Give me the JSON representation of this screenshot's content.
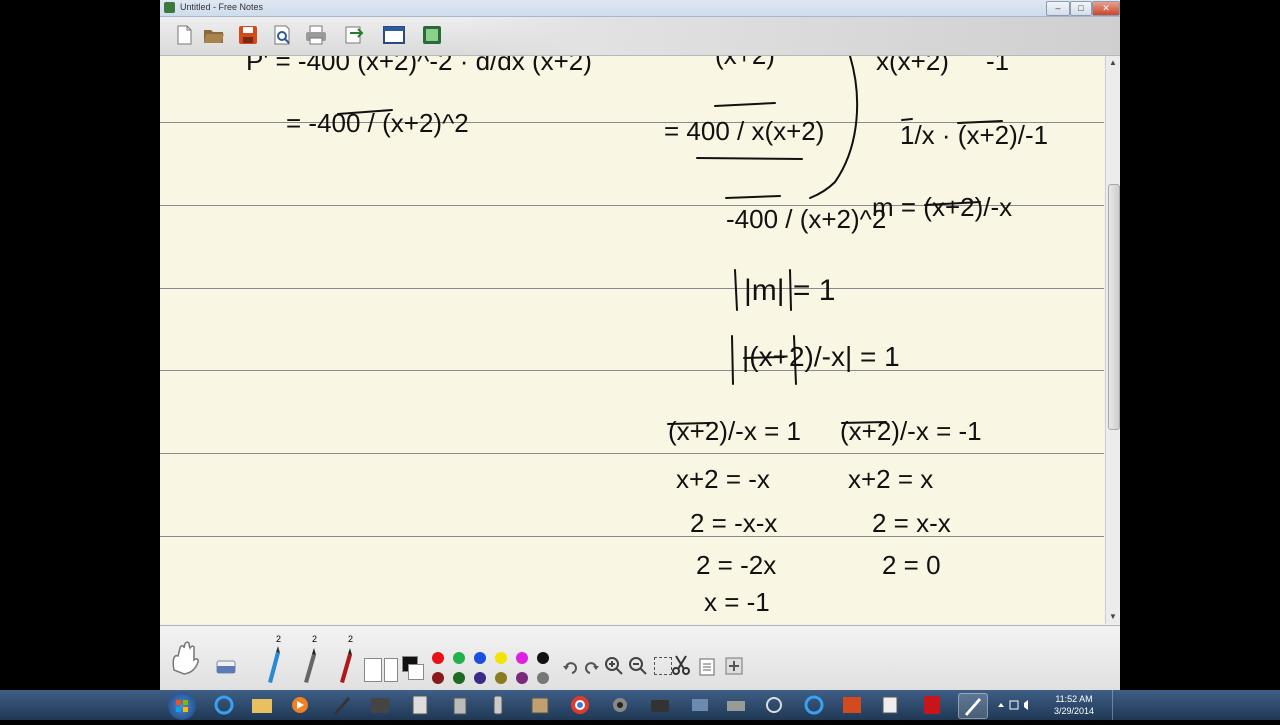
{
  "window": {
    "title": "Untitled - Free Notes",
    "controls": [
      "minimize",
      "maximize",
      "close"
    ]
  },
  "toolbar": {
    "buttons": [
      "new-document",
      "open-folder",
      "save",
      "print-preview",
      "print",
      "export",
      "full-screen",
      "insert-page"
    ]
  },
  "notes": {
    "left_column": [
      "P' = -400 (x+2)^-2 · d/dx (x+2)",
      "= -400 / (x+2)^2"
    ],
    "middle_top": [
      "(x+2)",
      "= 400 / x(x+2)",
      "-400 / (x+2)^2"
    ],
    "right_top": [
      "x(x+2)",
      "-1",
      "1/x · (x+2)/-1",
      "m = (x+2)/-x"
    ],
    "center_steps": [
      "|m| = 1",
      "|(x+2)/-x| = 1"
    ],
    "case_1": [
      "(x+2)/-x = 1",
      "x+2 = -x",
      "2 = -x-x",
      "2 = -2x",
      "x = -1"
    ],
    "case_2": [
      "(x+2)/-x = -1",
      "x+2 = x",
      "2 = x-x",
      "2 = 0"
    ]
  },
  "palette": {
    "pen_sizes": [
      "2",
      "2",
      "2"
    ],
    "row1_colors": [
      "#e8101b",
      "#22b14c",
      "#1b4fe0",
      "#f0e400",
      "#e020e0",
      "#111111"
    ],
    "row2_colors": [
      "#8a1a1a",
      "#1e6a22",
      "#3a2a8a",
      "#8a7a20",
      "#7a2a7a",
      "#777777"
    ]
  },
  "taskbar": {
    "time": "11:52 AM",
    "date": "3/29/2014"
  }
}
